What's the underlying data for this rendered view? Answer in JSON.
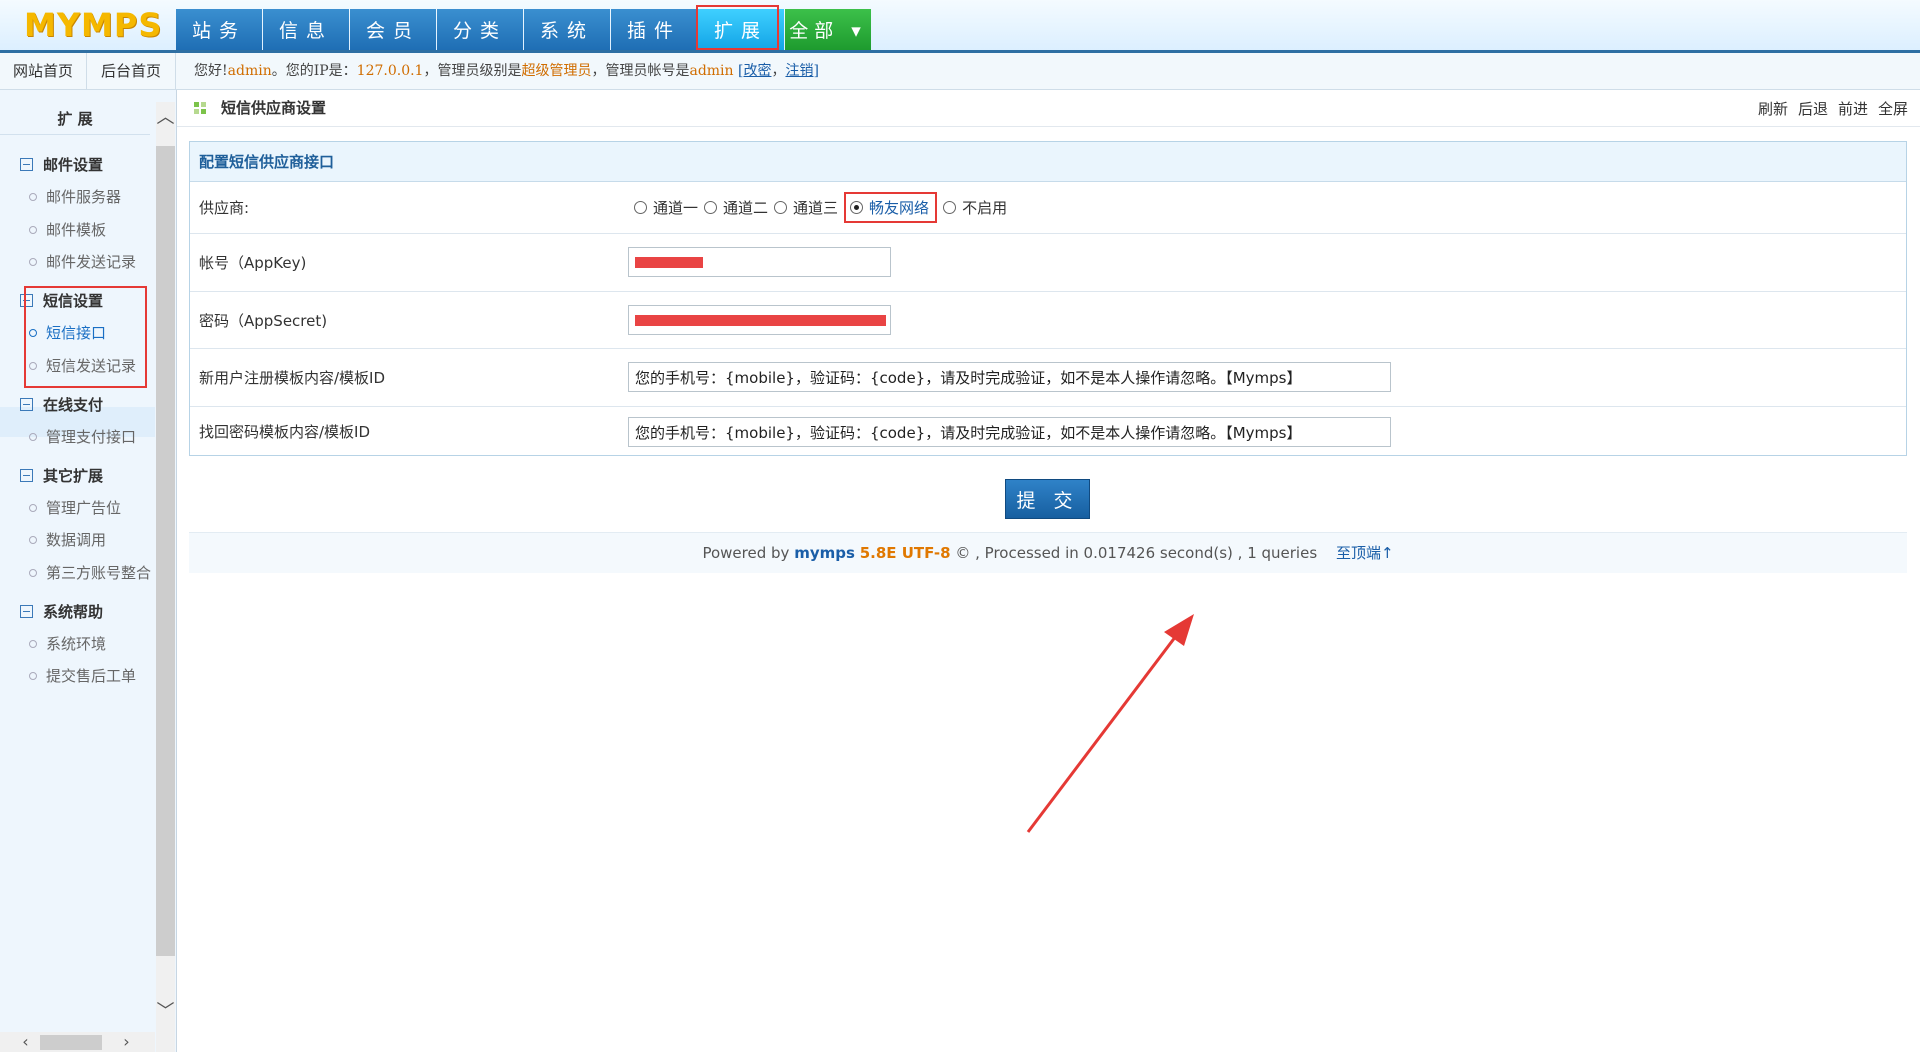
{
  "app": {
    "logo": "MYMPS"
  },
  "nav": {
    "items": [
      {
        "label": "站务"
      },
      {
        "label": "信息"
      },
      {
        "label": "会员"
      },
      {
        "label": "分类"
      },
      {
        "label": "系统"
      },
      {
        "label": "插件"
      },
      {
        "label": "扩展"
      },
      {
        "label": "全部 ▾"
      }
    ],
    "active": "扩展"
  },
  "subbar": {
    "site_home": "网站首页",
    "admin_home": "后台首页",
    "greeting": {
      "hello": "您好!",
      "user": "admin",
      "ip_label": "。您的IP是：",
      "ip": "127.0.0.1",
      "level_label": "，管理员级别是",
      "level": "超级管理员",
      "account_label": "，管理员帐号是",
      "account": "admin",
      "change_pwd": "改密",
      "logout": "注销"
    }
  },
  "sidebar": {
    "title": "扩 展",
    "groups": [
      {
        "label": "邮件设置",
        "items": [
          "邮件服务器",
          "邮件模板",
          "邮件发送记录"
        ]
      },
      {
        "label": "短信设置",
        "items": [
          "短信接口",
          "短信发送记录"
        ]
      },
      {
        "label": "在线支付",
        "items": [
          "管理支付接口"
        ]
      },
      {
        "label": "其它扩展",
        "items": [
          "管理广告位",
          "数据调用",
          "第三方账号整合"
        ]
      },
      {
        "label": "系统帮助",
        "items": [
          "系统环境",
          "提交售后工单"
        ]
      }
    ],
    "active_item": "短信接口"
  },
  "main": {
    "page_title": "短信供应商设置",
    "toolbar": {
      "refresh": "刷新",
      "back": "后退",
      "forward": "前进",
      "fullscreen": "全屏"
    },
    "panel_title": "配置短信供应商接口",
    "provider_label": "供应商:",
    "providers": [
      "通道一",
      "通道二",
      "通道三",
      "畅友网络",
      "不启用"
    ],
    "provider_selected": "畅友网络",
    "appkey_label": "帐号（AppKey)",
    "secret_label": "密码（AppSecret)",
    "register_label": "新用户注册模板内容/模板ID",
    "register_value": "您的手机号：{mobile}，验证码：{code}，请及时完成验证，如不是本人操作请忽略。【Mymps】",
    "findpwd_label": "找回密码模板内容/模板ID",
    "findpwd_value": "您的手机号：{mobile}，验证码：{code}，请及时完成验证，如不是本人操作请忽略。【Mymps】",
    "submit": "提 交"
  },
  "footer": {
    "powered": "Powered by",
    "brand": "mymps",
    "version": "5.8E UTF-8",
    "copy": "© , Processed in 0.017426 second(s) , 1 queries",
    "top_link": "至顶端↑"
  },
  "colors": {
    "accent": "#1f6eb4",
    "highlight": "#e53935",
    "active_nav": "#13a4e6"
  }
}
